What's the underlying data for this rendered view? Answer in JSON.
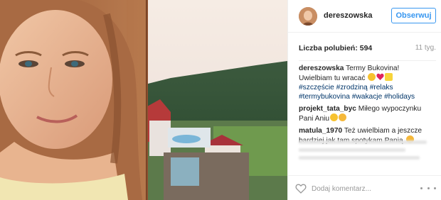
{
  "header": {
    "username": "dereszowska",
    "follow_label": "Obserwuj"
  },
  "stats": {
    "likes_label": "Liczba polubień: 594",
    "time_ago": "11 tyg."
  },
  "comments": [
    {
      "user": "dereszowska",
      "text_1": " Termy Bukovina!",
      "text_2": "Uwielbiam tu wracać ",
      "hashtags": [
        "#szczęście",
        "#zrodziną",
        "#relaks",
        "#termybukovina",
        "#wakacje",
        "#holidays"
      ]
    },
    {
      "user": "projekt_tata_byc",
      "text": " Miłego wypoczynku Pani Aniu"
    },
    {
      "user": "matula_1970",
      "text": " Też uwielbiam a jeszcze bardziej jak tam spotykam Panią "
    }
  ],
  "footer": {
    "comment_placeholder": "Dodaj komentarz..."
  },
  "icons": {
    "like": "heart-outline-icon",
    "more": "more-options-icon"
  },
  "colors": {
    "accent": "#3897f0",
    "hashtag": "#003569",
    "muted": "#999999"
  }
}
